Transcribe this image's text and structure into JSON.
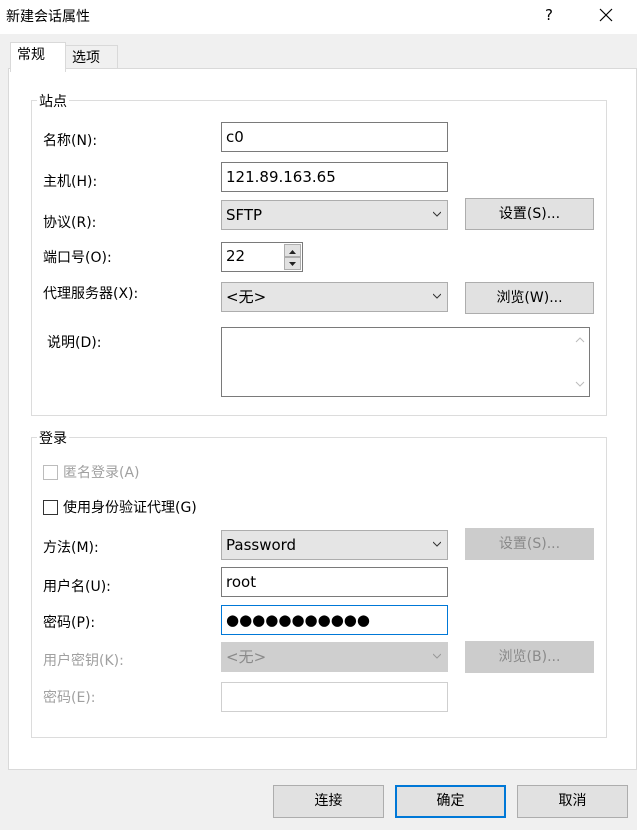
{
  "window": {
    "title": "新建会话属性",
    "help_label": "?",
    "close_icon": "close-icon"
  },
  "tabs": [
    {
      "label": "常规"
    },
    {
      "label": "选项"
    }
  ],
  "site": {
    "group_title": "站点",
    "name_label": "名称(N):",
    "name_value": "c0",
    "host_label": "主机(H):",
    "host_value": "121.89.163.65",
    "protocol_label": "协议(R):",
    "protocol_value": "SFTP",
    "protocol_settings_label": "设置(S)...",
    "port_label": "端口号(O):",
    "port_value": "22",
    "proxy_label": "代理服务器(X):",
    "proxy_value": "<无>",
    "proxy_browse_label": "浏览(W)...",
    "description_label": "说明(D):",
    "description_value": ""
  },
  "login": {
    "group_title": "登录",
    "anonymous_label": "匿名登录(A)",
    "anonymous_checked": false,
    "agent_label": "使用身份验证代理(G)",
    "agent_checked": false,
    "method_label": "方法(M):",
    "method_value": "Password",
    "method_settings_label": "设置(S)...",
    "username_label": "用户名(U):",
    "username_value": "root",
    "password_label": "密码(P):",
    "password_value": "●●●●●●●●●●●",
    "user_key_label": "用户密钥(K):",
    "user_key_value": "<无>",
    "user_key_browse_label": "浏览(B)...",
    "passphrase_label": "密码(E):",
    "passphrase_value": ""
  },
  "footer": {
    "connect_label": "连接",
    "ok_label": "确定",
    "cancel_label": "取消"
  },
  "colors": {
    "focus_accent": "#0078d7",
    "dialog_background": "#f0f0f0",
    "disabled_text": "#a0a0a0"
  }
}
